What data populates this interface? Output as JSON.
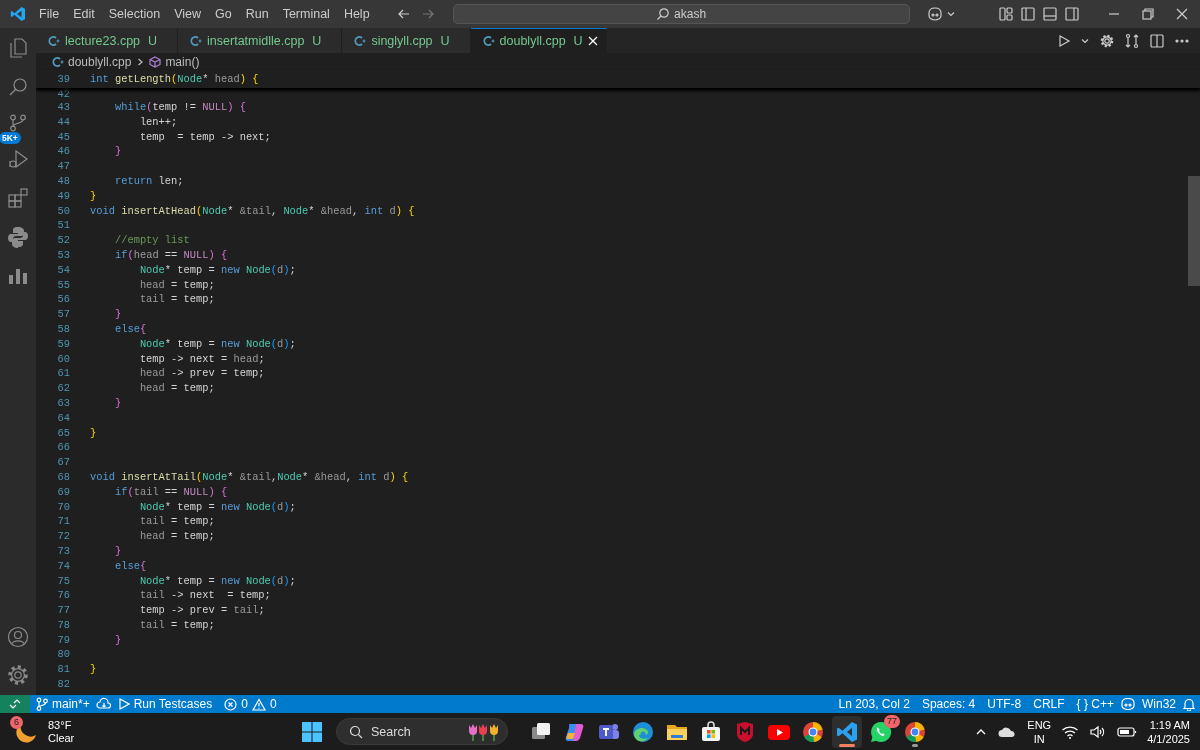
{
  "menu": [
    "File",
    "Edit",
    "Selection",
    "View",
    "Go",
    "Run",
    "Terminal",
    "Help"
  ],
  "command_center": {
    "value": "akash"
  },
  "tabs": [
    {
      "label": "lecture23.cpp",
      "status": "U",
      "selected": false
    },
    {
      "label": "insertatmidlle.cpp",
      "status": "U",
      "selected": false
    },
    {
      "label": "singlyll.cpp",
      "status": "U",
      "selected": false
    },
    {
      "label": "doublyll.cpp",
      "status": "U",
      "selected": true
    }
  ],
  "breadcrumb": {
    "file": "doublyll.cpp",
    "symbol": "main()"
  },
  "activity_bar": {
    "source_control_badge": "5K+"
  },
  "sticky_line": {
    "number": "39",
    "tokens": [
      {
        "text": "int",
        "kind": "keyword"
      },
      {
        "text": " getLength",
        "kind": "function"
      },
      {
        "text": "(",
        "kind": "bracket1"
      },
      {
        "text": "Node",
        "kind": "type"
      },
      {
        "text": "* ",
        "kind": "plain"
      },
      {
        "text": "head",
        "kind": "parameter"
      },
      {
        "text": ")",
        "kind": "bracket1"
      },
      {
        "text": " {",
        "kind": "bracket1"
      }
    ]
  },
  "lines": [
    {
      "number": "42"
    },
    {
      "number": "43",
      "tokens": [
        {
          "text": "    while",
          "kind": "keyword"
        },
        {
          "text": "(",
          "kind": "bracket2"
        },
        {
          "text": "temp != ",
          "kind": "plain"
        },
        {
          "text": "NULL",
          "kind": "macro"
        },
        {
          "text": ")",
          "kind": "bracket2"
        },
        {
          "text": " {",
          "kind": "bracket2"
        }
      ]
    },
    {
      "number": "44",
      "tokens": [
        {
          "text": "        len++;",
          "kind": "plain"
        }
      ]
    },
    {
      "number": "45",
      "tokens": [
        {
          "text": "        temp  = temp -> next;",
          "kind": "plain"
        }
      ]
    },
    {
      "number": "46",
      "tokens": [
        {
          "text": "    }",
          "kind": "bracket2"
        }
      ]
    },
    {
      "number": "47"
    },
    {
      "number": "48",
      "tokens": [
        {
          "text": "    return",
          "kind": "keyword"
        },
        {
          "text": " len;",
          "kind": "plain"
        }
      ]
    },
    {
      "number": "49",
      "tokens": [
        {
          "text": "}",
          "kind": "bracket1"
        }
      ]
    },
    {
      "number": "50",
      "tokens": [
        {
          "text": "void",
          "kind": "keyword"
        },
        {
          "text": " insertAtHead",
          "kind": "function"
        },
        {
          "text": "(",
          "kind": "bracket1"
        },
        {
          "text": "Node",
          "kind": "type"
        },
        {
          "text": "* ",
          "kind": "plain"
        },
        {
          "text": "&tail",
          "kind": "parameter"
        },
        {
          "text": ", ",
          "kind": "plain"
        },
        {
          "text": "Node",
          "kind": "type"
        },
        {
          "text": "* ",
          "kind": "plain"
        },
        {
          "text": "&head",
          "kind": "parameter"
        },
        {
          "text": ", ",
          "kind": "plain"
        },
        {
          "text": "int",
          "kind": "keyword"
        },
        {
          "text": " d",
          "kind": "parameter"
        },
        {
          "text": ")",
          "kind": "bracket1"
        },
        {
          "text": " {",
          "kind": "bracket1"
        }
      ]
    },
    {
      "number": "51"
    },
    {
      "number": "52",
      "tokens": [
        {
          "text": "    //empty list",
          "kind": "comment"
        }
      ]
    },
    {
      "number": "53",
      "tokens": [
        {
          "text": "    if",
          "kind": "keyword"
        },
        {
          "text": "(",
          "kind": "bracket2"
        },
        {
          "text": "head",
          "kind": "parameter"
        },
        {
          "text": " == ",
          "kind": "plain"
        },
        {
          "text": "NULL",
          "kind": "macro"
        },
        {
          "text": ")",
          "kind": "bracket2"
        },
        {
          "text": " {",
          "kind": "bracket2"
        }
      ]
    },
    {
      "number": "54",
      "tokens": [
        {
          "text": "        Node",
          "kind": "type"
        },
        {
          "text": "* temp = ",
          "kind": "plain"
        },
        {
          "text": "new ",
          "kind": "keyword"
        },
        {
          "text": "Node",
          "kind": "type"
        },
        {
          "text": "(",
          "kind": "bracket3"
        },
        {
          "text": "d",
          "kind": "parameter"
        },
        {
          "text": ")",
          "kind": "bracket3"
        },
        {
          "text": ";",
          "kind": "plain"
        }
      ]
    },
    {
      "number": "55",
      "tokens": [
        {
          "text": "        head",
          "kind": "parameter"
        },
        {
          "text": " = temp;",
          "kind": "plain"
        }
      ]
    },
    {
      "number": "56",
      "tokens": [
        {
          "text": "        tail",
          "kind": "parameter"
        },
        {
          "text": " = temp;",
          "kind": "plain"
        }
      ]
    },
    {
      "number": "57",
      "tokens": [
        {
          "text": "    }",
          "kind": "bracket2"
        }
      ]
    },
    {
      "number": "58",
      "tokens": [
        {
          "text": "    else",
          "kind": "keyword"
        },
        {
          "text": "{",
          "kind": "bracket2"
        }
      ]
    },
    {
      "number": "59",
      "tokens": [
        {
          "text": "        Node",
          "kind": "type"
        },
        {
          "text": "* temp = ",
          "kind": "plain"
        },
        {
          "text": "new ",
          "kind": "keyword"
        },
        {
          "text": "Node",
          "kind": "type"
        },
        {
          "text": "(",
          "kind": "bracket3"
        },
        {
          "text": "d",
          "kind": "parameter"
        },
        {
          "text": ")",
          "kind": "bracket3"
        },
        {
          "text": ";",
          "kind": "plain"
        }
      ]
    },
    {
      "number": "60",
      "tokens": [
        {
          "text": "        temp -> next = ",
          "kind": "plain"
        },
        {
          "text": "head",
          "kind": "parameter"
        },
        {
          "text": ";",
          "kind": "plain"
        }
      ]
    },
    {
      "number": "61",
      "tokens": [
        {
          "text": "        head",
          "kind": "parameter"
        },
        {
          "text": " -> prev = temp;",
          "kind": "plain"
        }
      ]
    },
    {
      "number": "62",
      "tokens": [
        {
          "text": "        head",
          "kind": "parameter"
        },
        {
          "text": " = temp;",
          "kind": "plain"
        }
      ]
    },
    {
      "number": "63",
      "tokens": [
        {
          "text": "    }",
          "kind": "bracket2"
        }
      ]
    },
    {
      "number": "64"
    },
    {
      "number": "65",
      "tokens": [
        {
          "text": "}",
          "kind": "bracket1"
        }
      ]
    },
    {
      "number": "66"
    },
    {
      "number": "67"
    },
    {
      "number": "68",
      "tokens": [
        {
          "text": "void",
          "kind": "keyword"
        },
        {
          "text": " insertAtTail",
          "kind": "function"
        },
        {
          "text": "(",
          "kind": "bracket1"
        },
        {
          "text": "Node",
          "kind": "type"
        },
        {
          "text": "* ",
          "kind": "plain"
        },
        {
          "text": "&tail",
          "kind": "parameter"
        },
        {
          "text": ",",
          "kind": "plain"
        },
        {
          "text": "Node",
          "kind": "type"
        },
        {
          "text": "* ",
          "kind": "plain"
        },
        {
          "text": "&head",
          "kind": "parameter"
        },
        {
          "text": ", ",
          "kind": "plain"
        },
        {
          "text": "int",
          "kind": "keyword"
        },
        {
          "text": " d",
          "kind": "parameter"
        },
        {
          "text": ")",
          "kind": "bracket1"
        },
        {
          "text": " {",
          "kind": "bracket1"
        }
      ]
    },
    {
      "number": "69",
      "tokens": [
        {
          "text": "    if",
          "kind": "keyword"
        },
        {
          "text": "(",
          "kind": "bracket2"
        },
        {
          "text": "tail",
          "kind": "parameter"
        },
        {
          "text": " == ",
          "kind": "plain"
        },
        {
          "text": "NULL",
          "kind": "macro"
        },
        {
          "text": ")",
          "kind": "bracket2"
        },
        {
          "text": " {",
          "kind": "bracket2"
        }
      ]
    },
    {
      "number": "70",
      "tokens": [
        {
          "text": "        Node",
          "kind": "type"
        },
        {
          "text": "* temp = ",
          "kind": "plain"
        },
        {
          "text": "new ",
          "kind": "keyword"
        },
        {
          "text": "Node",
          "kind": "type"
        },
        {
          "text": "(",
          "kind": "bracket3"
        },
        {
          "text": "d",
          "kind": "parameter"
        },
        {
          "text": ")",
          "kind": "bracket3"
        },
        {
          "text": ";",
          "kind": "plain"
        }
      ]
    },
    {
      "number": "71",
      "tokens": [
        {
          "text": "        tail",
          "kind": "parameter"
        },
        {
          "text": " = temp;",
          "kind": "plain"
        }
      ]
    },
    {
      "number": "72",
      "tokens": [
        {
          "text": "        head",
          "kind": "parameter"
        },
        {
          "text": " = temp;",
          "kind": "plain"
        }
      ]
    },
    {
      "number": "73",
      "tokens": [
        {
          "text": "    }",
          "kind": "bracket2"
        }
      ]
    },
    {
      "number": "74",
      "tokens": [
        {
          "text": "    else",
          "kind": "keyword"
        },
        {
          "text": "{",
          "kind": "bracket2"
        }
      ]
    },
    {
      "number": "75",
      "tokens": [
        {
          "text": "        Node",
          "kind": "type"
        },
        {
          "text": "* temp = ",
          "kind": "plain"
        },
        {
          "text": "new ",
          "kind": "keyword"
        },
        {
          "text": "Node",
          "kind": "type"
        },
        {
          "text": "(",
          "kind": "bracket3"
        },
        {
          "text": "d",
          "kind": "parameter"
        },
        {
          "text": ")",
          "kind": "bracket3"
        },
        {
          "text": ";",
          "kind": "plain"
        }
      ]
    },
    {
      "number": "76",
      "tokens": [
        {
          "text": "        tail",
          "kind": "parameter"
        },
        {
          "text": " -> next  = temp;",
          "kind": "plain"
        }
      ]
    },
    {
      "number": "77",
      "tokens": [
        {
          "text": "        temp -> prev = ",
          "kind": "plain"
        },
        {
          "text": "tail",
          "kind": "parameter"
        },
        {
          "text": ";",
          "kind": "plain"
        }
      ]
    },
    {
      "number": "78",
      "tokens": [
        {
          "text": "        tail",
          "kind": "parameter"
        },
        {
          "text": " = temp;",
          "kind": "plain"
        }
      ]
    },
    {
      "number": "79",
      "tokens": [
        {
          "text": "    }",
          "kind": "bracket2"
        }
      ]
    },
    {
      "number": "80"
    },
    {
      "number": "81",
      "tokens": [
        {
          "text": "}",
          "kind": "bracket1"
        }
      ]
    },
    {
      "number": "82"
    }
  ],
  "status_bar": {
    "branch": "main*+",
    "run": "Run Testcases",
    "errors": "0",
    "warnings": "0",
    "position": "Ln 203, Col 2",
    "spaces": "Spaces: 4",
    "encoding": "UTF-8",
    "eol": "CRLF",
    "language_braces": "{ }",
    "language": "C++",
    "platform": "Win32"
  },
  "taskbar": {
    "weather_badge": "6",
    "temperature": "83°F",
    "condition": "Clear",
    "search_placeholder": "Search",
    "apps": [
      {
        "kind": "task_view",
        "selected": false,
        "running": false
      },
      {
        "kind": "copilot",
        "selected": false,
        "running": false
      },
      {
        "kind": "teams",
        "selected": false,
        "running": false
      },
      {
        "kind": "edge",
        "selected": false,
        "running": false
      },
      {
        "kind": "folder",
        "selected": false,
        "running": false
      },
      {
        "kind": "store",
        "selected": false,
        "running": false
      },
      {
        "kind": "shield",
        "selected": false,
        "running": false
      },
      {
        "kind": "video",
        "selected": false,
        "running": false
      },
      {
        "kind": "browser",
        "selected": false,
        "running": false
      },
      {
        "kind": "code",
        "selected": true,
        "running": true
      },
      {
        "kind": "chat",
        "selected": false,
        "running": false,
        "badge": "77"
      },
      {
        "kind": "browser_profile",
        "selected": false,
        "running": true
      }
    ],
    "language": "ENG",
    "region": "IN",
    "time": "1:19 AM",
    "date": "4/1/2025"
  }
}
